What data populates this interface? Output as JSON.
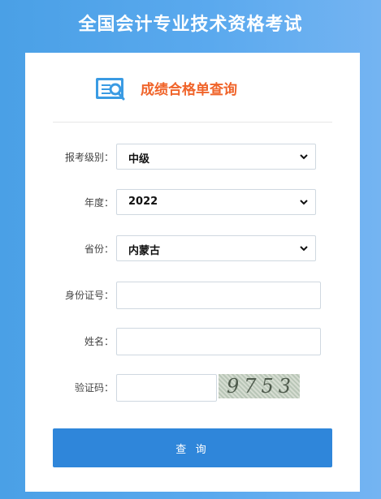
{
  "page": {
    "title": "全国会计专业技术资格考试"
  },
  "header": {
    "title": "成绩合格单查询",
    "icon": "search-list-icon"
  },
  "form": {
    "level": {
      "label": "报考级别：",
      "value": "中级"
    },
    "year": {
      "label": "年度：",
      "value": "2022"
    },
    "province": {
      "label": "省份：",
      "value": "内蒙古"
    },
    "id_number": {
      "label": "身份证号：",
      "value": ""
    },
    "name": {
      "label": "姓名：",
      "value": ""
    },
    "captcha": {
      "label": "验证码：",
      "value": "",
      "image_text": "9753"
    }
  },
  "actions": {
    "query_label": "查 询"
  },
  "colors": {
    "background": "#4aa0e6",
    "accent": "#f0642a",
    "button": "#2f86da"
  }
}
